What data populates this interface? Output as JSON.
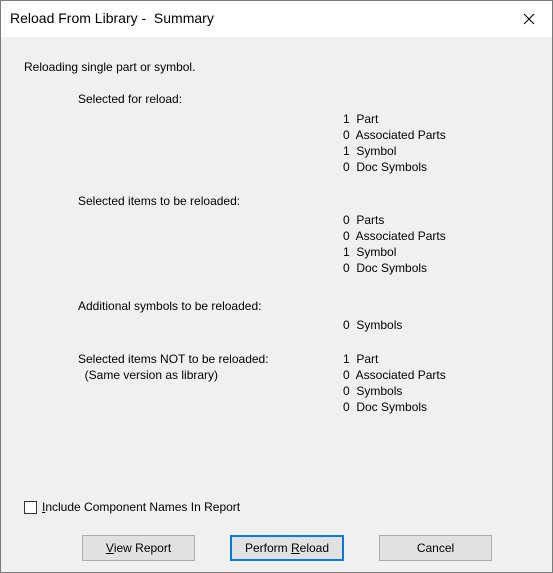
{
  "window": {
    "title": "Reload From Library -  Summary"
  },
  "intro": "Reloading single part or symbol.",
  "sections": [
    {
      "label": "Selected for reload:",
      "sublabel": "",
      "values": [
        "1  Part",
        "0  Associated Parts",
        "1  Symbol",
        "0  Doc Symbols"
      ]
    },
    {
      "label": "Selected items to be reloaded:",
      "sublabel": "",
      "values": [
        "0  Parts",
        "0  Associated Parts",
        "1  Symbol",
        "0  Doc Symbols"
      ]
    },
    {
      "label": "Additional symbols to be reloaded:",
      "sublabel": "",
      "values": [
        "0  Symbols"
      ]
    },
    {
      "label": "Selected items NOT to be reloaded:",
      "sublabel": "  (Same version as library)",
      "values": [
        "1  Part",
        "0  Associated Parts",
        "0  Symbols",
        "0  Doc Symbols"
      ]
    }
  ],
  "include_names": {
    "mnemonic": "I",
    "rest": "nclude Component Names In Report",
    "checked": false
  },
  "buttons": {
    "view_report": {
      "mnemonic": "V",
      "rest": "iew Report"
    },
    "perform_reload": {
      "before": "Perform ",
      "mnemonic": "R",
      "rest": "eload"
    },
    "cancel": {
      "label": "Cancel"
    }
  },
  "colors": {
    "client_bg": "#f0f0f0",
    "titlebar_bg": "#ffffff",
    "default_button_border": "#0078d7",
    "button_bg": "#e1e1e1"
  },
  "icons": {
    "close": "close-icon"
  }
}
